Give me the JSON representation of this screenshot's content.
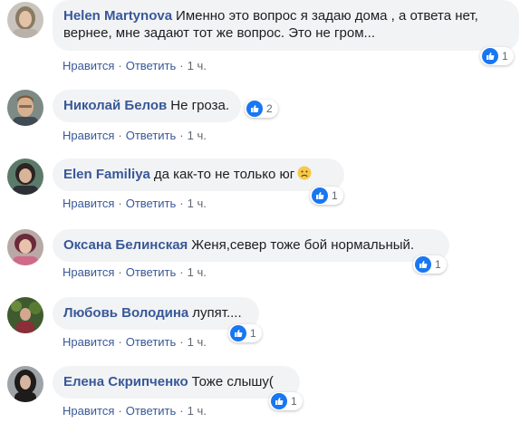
{
  "like_label": "Нравится",
  "reply_label": "Ответить",
  "comments": [
    {
      "author": "Helen Martynova",
      "text": "Именно это вопрос я задаю дома , а ответа нет, вернее, мне задают тот же вопрос. Это не гром...",
      "reactions": "1",
      "time": "1 ч.",
      "avatar_icon": "avatar-photo"
    },
    {
      "author": "Николай Белов",
      "text": "Не гроза.",
      "reactions": "2",
      "time": "1 ч.",
      "avatar_icon": "avatar-photo"
    },
    {
      "author": "Elen Familiya",
      "text": "да как-то не только юг",
      "emoji": "sad-face-emoji",
      "reactions": "1",
      "time": "1 ч.",
      "avatar_icon": "avatar-photo"
    },
    {
      "author": "Оксана Белинская",
      "text": "Женя,север тоже бой нормальный.",
      "reactions": "1",
      "time": "1 ч.",
      "avatar_icon": "avatar-photo"
    },
    {
      "author": "Любовь Володина",
      "text": "лупят....",
      "reactions": "1",
      "time": "1 ч.",
      "avatar_icon": "avatar-photo"
    },
    {
      "author": "Елена Скрипченко",
      "text": "Тоже слышу(",
      "reactions": "1",
      "time": "1 ч.",
      "avatar_icon": "avatar-photo"
    }
  ],
  "colors": {
    "author": "#385898",
    "bubble": "#f2f3f5",
    "like": "#1877f2",
    "meta": "#606770"
  }
}
